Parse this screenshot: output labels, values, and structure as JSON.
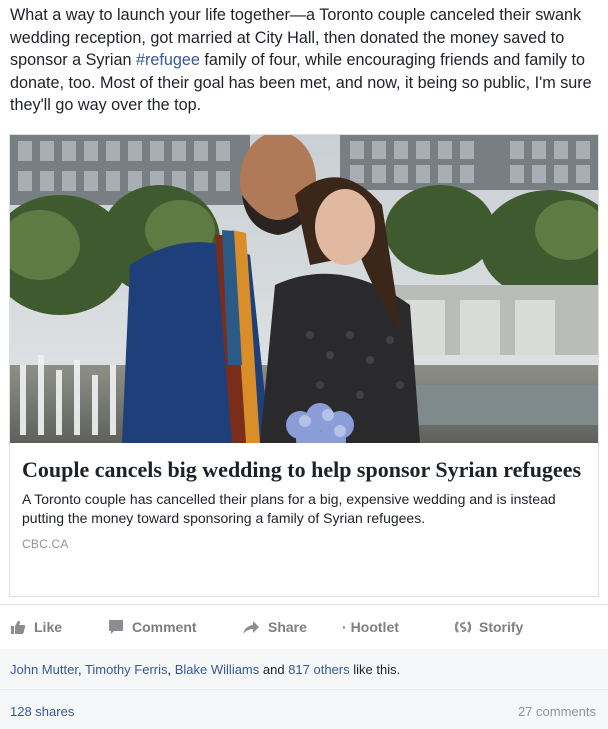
{
  "post": {
    "text_before": "What a way to launch your life together—a Toronto couple canceled their swank wedding reception, got married at City Hall, then donated the money saved to sponsor a Syrian ",
    "hashtag": "#refugee",
    "text_after": " family of four, while encouraging friends and family to donate, too. Most of their goal has been met, and now, it being so public, I'm sure they'll go way over the top."
  },
  "link_card": {
    "image_icon": "photo-couple-city-hall",
    "title": "Couple cancels big wedding to help sponsor Syrian refugees",
    "description": "A Toronto couple has cancelled their plans for a big, expensive wedding and is instead putting the money toward sponsoring a family of Syrian refugees.",
    "domain": "CBC.CA"
  },
  "actions": {
    "like": "Like",
    "comment": "Comment",
    "share": "Share",
    "hootlet": "Hootlet",
    "storify": "Storify"
  },
  "likes": {
    "name1": "John Mutter",
    "sep1": ", ",
    "name2": "Timothy Ferris",
    "sep2": ", ",
    "name3": "Blake Williams",
    "and": " and ",
    "others": "817 others",
    "suffix": " like this."
  },
  "stats": {
    "shares": "128 shares",
    "comments": "27 comments"
  },
  "colors": {
    "link": "#365899",
    "action_gray": "#7f7f7f",
    "meta_gray": "#90949c"
  }
}
